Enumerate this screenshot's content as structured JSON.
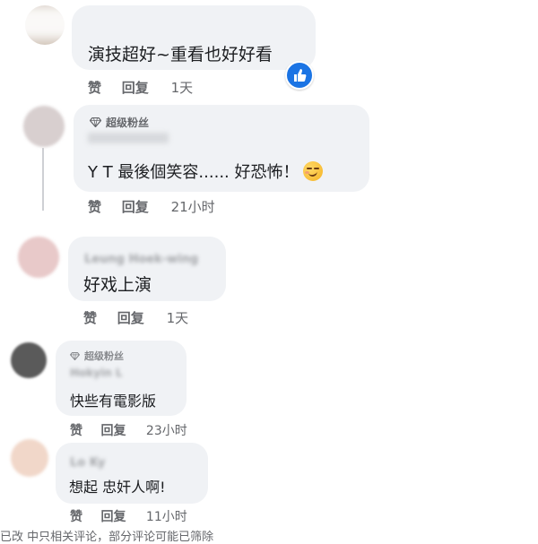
{
  "colors": {
    "bubble": "#f0f2f5",
    "meta_text": "#65676b",
    "body_text": "#1c1e21",
    "like_blue": "#1b74e4"
  },
  "comments": [
    {
      "text": "演技超好~重看也好好看",
      "actions": {
        "like": "赞",
        "reply": "回复",
        "time": "1天"
      },
      "reaction_icon": "thumbs-up-icon"
    },
    {
      "badge": "超级粉丝",
      "text": "Y T 最後個笑容...... 好恐怖！",
      "emoji": "smirk-emoji-icon",
      "actions": {
        "like": "赞",
        "reply": "回复",
        "time": "21小时"
      }
    },
    {
      "author": "Leung Hoek-wing",
      "text": "好戏上演",
      "actions": {
        "like": "赞",
        "reply": "回复",
        "time": "1天"
      }
    },
    {
      "badge": "超级粉丝",
      "author": "Hokyin L",
      "text": "快些有電影版",
      "actions": {
        "like": "赞",
        "reply": "回复",
        "time": "23小时"
      }
    },
    {
      "author": "Lo Ky",
      "text": "想起 忠奸人啊!",
      "actions": {
        "like": "赞",
        "reply": "回复",
        "time": "11小时"
      }
    }
  ],
  "footer_partial": "已改 中只相关评论，部分评论可能已筛除"
}
